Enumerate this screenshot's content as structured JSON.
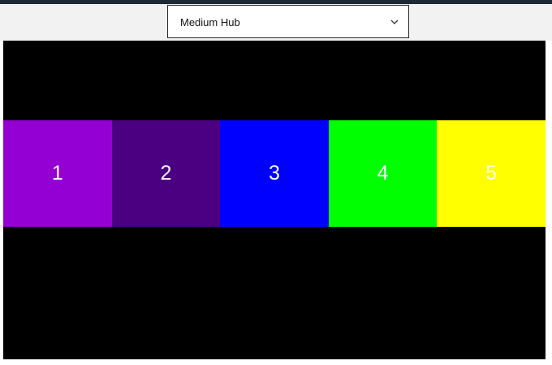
{
  "hub_select": {
    "selected": "Medium Hub"
  },
  "tiles": [
    {
      "label": "1",
      "color": "#9400d3"
    },
    {
      "label": "2",
      "color": "#4b0082"
    },
    {
      "label": "3",
      "color": "#0000ff"
    },
    {
      "label": "4",
      "color": "#00ff00"
    },
    {
      "label": "5",
      "color": "#ffff00"
    }
  ],
  "colors": {
    "top_bar": "#1d2a35",
    "toolbar": "#f2f2f2",
    "stage": "#000000"
  },
  "icons": {
    "select_chevron": "chevron-down-icon"
  }
}
